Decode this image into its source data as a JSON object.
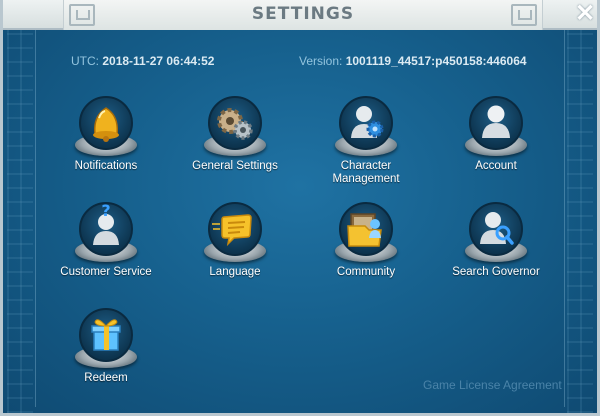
{
  "window": {
    "title": "SETTINGS",
    "close_label": "✕"
  },
  "info": {
    "utc_label": "UTC:",
    "utc_value": "2018-11-27 06:44:52",
    "version_label": "Version:",
    "version_value": "1001119_44517:p450158:446064"
  },
  "items": [
    {
      "label": "Notifications",
      "icon": "bell-icon"
    },
    {
      "label": "General Settings",
      "icon": "gears-icon"
    },
    {
      "label": "Character Management",
      "icon": "character-gear-icon"
    },
    {
      "label": "Account",
      "icon": "account-icon"
    },
    {
      "label": "Customer Service",
      "icon": "customer-service-icon"
    },
    {
      "label": "Language",
      "icon": "language-icon"
    },
    {
      "label": "Community",
      "icon": "community-icon"
    },
    {
      "label": "Search Governor",
      "icon": "search-governor-icon"
    },
    {
      "label": "Redeem",
      "icon": "gift-icon"
    }
  ],
  "footer": {
    "license_link": "Game License Agreement"
  },
  "colors": {
    "panel": "#16608d",
    "frame": "#b9c7cf",
    "title_text": "#6b7a82",
    "label_text": "#ffffff"
  }
}
